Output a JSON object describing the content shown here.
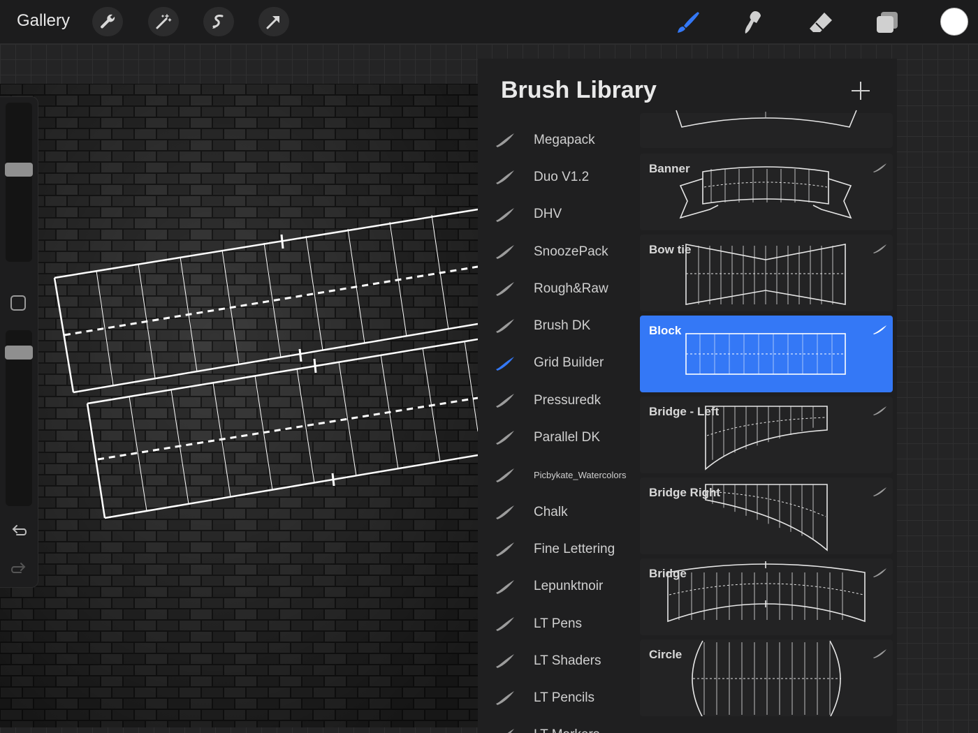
{
  "topbar": {
    "gallery_label": "Gallery",
    "left_tools": [
      "wrench-icon",
      "magic-wand-icon",
      "selection-icon",
      "transform-arrow-icon"
    ],
    "right_tools": [
      "brush-icon",
      "smudge-icon",
      "eraser-icon",
      "layers-icon"
    ],
    "active_tool": "brush-icon",
    "current_color": "#ffffff",
    "accent_color": "#3478f6"
  },
  "library": {
    "title": "Brush Library",
    "sets": [
      {
        "label": "Megapack"
      },
      {
        "label": "Duo V1.2"
      },
      {
        "label": "DHV"
      },
      {
        "label": "SnoozePack"
      },
      {
        "label": "Rough&Raw"
      },
      {
        "label": "Brush DK"
      },
      {
        "label": "Grid Builder",
        "selected": true
      },
      {
        "label": "Pressuredk"
      },
      {
        "label": "Parallel DK"
      },
      {
        "label": "Picbykate_Watercolors"
      },
      {
        "label": "Chalk"
      },
      {
        "label": "Fine Lettering"
      },
      {
        "label": "Lepunktnoir"
      },
      {
        "label": "LT Pens"
      },
      {
        "label": "LT Shaders"
      },
      {
        "label": "LT Pencils"
      },
      {
        "label": "LT Markers"
      }
    ],
    "brushes": [
      {
        "name": "",
        "preview": "arc"
      },
      {
        "name": "Banner",
        "preview": "banner"
      },
      {
        "name": "Bow tie",
        "preview": "bowtie"
      },
      {
        "name": "Block",
        "preview": "block",
        "selected": true
      },
      {
        "name": "Bridge - Left",
        "preview": "bridge-left"
      },
      {
        "name": "Bridge Right",
        "preview": "bridge-right"
      },
      {
        "name": "Bridge",
        "preview": "bridge"
      },
      {
        "name": "Circle",
        "preview": "circle"
      }
    ]
  }
}
